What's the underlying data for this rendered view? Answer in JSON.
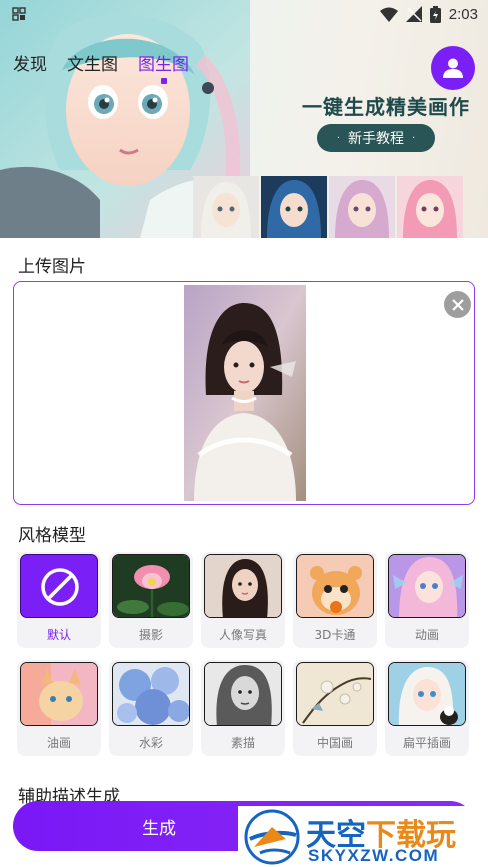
{
  "status_bar": {
    "time": "2:03",
    "icons": [
      "notification-icon",
      "wifi-icon",
      "signal-icon",
      "battery-icon"
    ]
  },
  "tabs": [
    {
      "label": "发现",
      "active": false
    },
    {
      "label": "文生图",
      "active": false
    },
    {
      "label": "图生图",
      "active": true
    }
  ],
  "banner": {
    "headline": "一键生成精美画作",
    "tutorial_label": "新手教程"
  },
  "upload": {
    "title": "上传图片"
  },
  "style_section": {
    "title": "风格模型",
    "items": [
      {
        "label": "默认",
        "selected": true
      },
      {
        "label": "摄影",
        "selected": false
      },
      {
        "label": "人像写真",
        "selected": false
      },
      {
        "label": "3D卡通",
        "selected": false
      },
      {
        "label": "动画",
        "selected": false
      },
      {
        "label": "油画",
        "selected": false
      },
      {
        "label": "水彩",
        "selected": false
      },
      {
        "label": "素描",
        "selected": false
      },
      {
        "label": "中国画",
        "selected": false
      },
      {
        "label": "扁平插画",
        "selected": false
      }
    ]
  },
  "description": {
    "title": "辅助描述生成"
  },
  "generate": {
    "label": "生成"
  },
  "watermark": {
    "title_main": "天空",
    "title_accent": "下载玩",
    "subtitle": "SKYXZW.COM"
  },
  "colors": {
    "accent": "#7a1ff5",
    "banner_button": "#2a5557",
    "watermark_blue": "#1565c0",
    "watermark_orange": "#e8891a"
  }
}
